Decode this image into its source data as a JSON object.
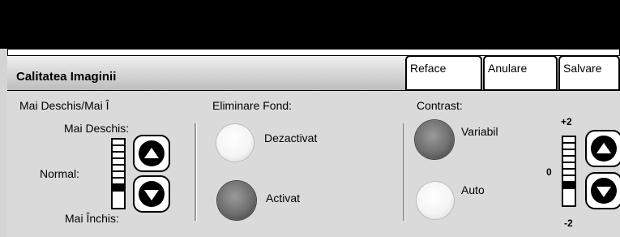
{
  "header": {
    "title": "Calitatea Imaginii",
    "buttons": {
      "reface": "Reface",
      "anulare": "Anulare",
      "salvare": "Salvare"
    }
  },
  "lightness": {
    "heading": "Mai Deschis/Mai Î",
    "top_label": "Mai Deschis:",
    "mid_label": "Normal:",
    "bottom_label": "Mai Închis:",
    "level_fraction": 0.125
  },
  "background": {
    "heading": "Eliminare Fond:",
    "options": [
      {
        "label": "Dezactivat",
        "selected": false
      },
      {
        "label": "Activat",
        "selected": true
      }
    ]
  },
  "contrast": {
    "heading": "Contrast:",
    "options": [
      {
        "label": "Variabil",
        "selected": true
      },
      {
        "label": "Auto",
        "selected": false
      }
    ],
    "scale_top": "+2",
    "scale_mid": "0",
    "scale_bottom": "-2",
    "level_fraction": 0.125
  },
  "icons": {
    "up": "up-arrow-icon",
    "down": "down-arrow-icon"
  }
}
